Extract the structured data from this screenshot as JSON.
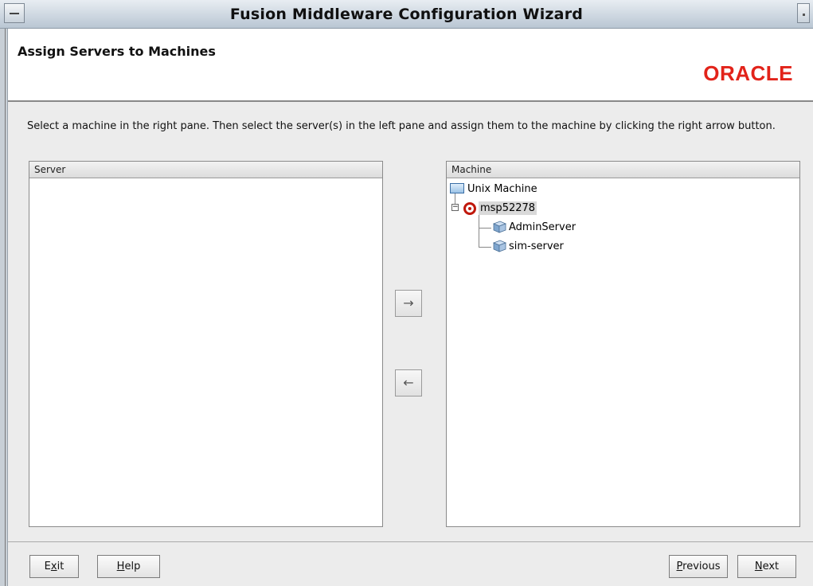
{
  "window": {
    "title": "Fusion Middleware Configuration Wizard"
  },
  "header": {
    "title": "Assign Servers to Machines",
    "logo_text": "ORACLE",
    "logo_color": "#e2231a"
  },
  "instruction": "Select a machine in the right pane. Then select the server(s) in the left pane and assign them to the machine by clicking the right arrow button.",
  "server_pane": {
    "header": "Server",
    "items": []
  },
  "machine_pane": {
    "header": "Machine",
    "tree": {
      "root": "Unix Machine",
      "machine": {
        "name": "msp52278",
        "expanded": true,
        "selected": true,
        "servers": [
          "AdminServer",
          "sim-server"
        ]
      }
    }
  },
  "arrows": {
    "assign": "→",
    "unassign": "←"
  },
  "buttons": {
    "exit": {
      "mnemonic_pre": "E",
      "mnemonic": "x",
      "mnemonic_post": "it"
    },
    "help": {
      "mnemonic_pre": "",
      "mnemonic": "H",
      "mnemonic_post": "elp"
    },
    "previous": {
      "mnemonic_pre": "",
      "mnemonic": "P",
      "mnemonic_post": "revious"
    },
    "next": {
      "mnemonic_pre": "",
      "mnemonic": "N",
      "mnemonic_post": "ext"
    }
  },
  "icons": {
    "folder": "folder-icon",
    "machine": "machine-icon",
    "server": "server-icon"
  }
}
